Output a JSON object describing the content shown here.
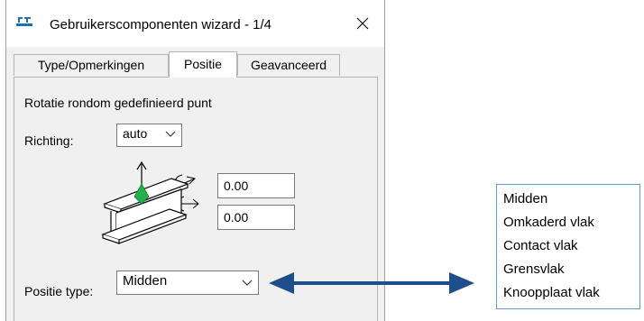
{
  "window": {
    "title": "Gebruikerscomponenten wizard - 1/4"
  },
  "tabs": [
    {
      "label": "Type/Opmerkingen",
      "active": false
    },
    {
      "label": "Positie",
      "active": true
    },
    {
      "label": "Geavanceerd",
      "active": false
    }
  ],
  "positie": {
    "heading": "Rotatie rondom gedefinieerd punt",
    "richting_label": "Richting:",
    "richting_value": "auto",
    "rotation_value_1": "0.00",
    "rotation_value_2": "0.00",
    "positie_type_label": "Positie type:",
    "positie_type_value": "Midden"
  },
  "dropdown_options": [
    "Midden",
    "Omkaderd vlak",
    "Contact vlak",
    "Grensvlak",
    "Knoopplaat vlak"
  ],
  "colors": {
    "arrow": "#1f4e8c",
    "list_border": "#5b9bd5",
    "origin_marker": "#22b14c"
  },
  "icons": {
    "app": "app-logo-icon",
    "close": "close-icon",
    "chevron": "chevron-down-icon",
    "beam": "i-beam-rotation-icon"
  }
}
